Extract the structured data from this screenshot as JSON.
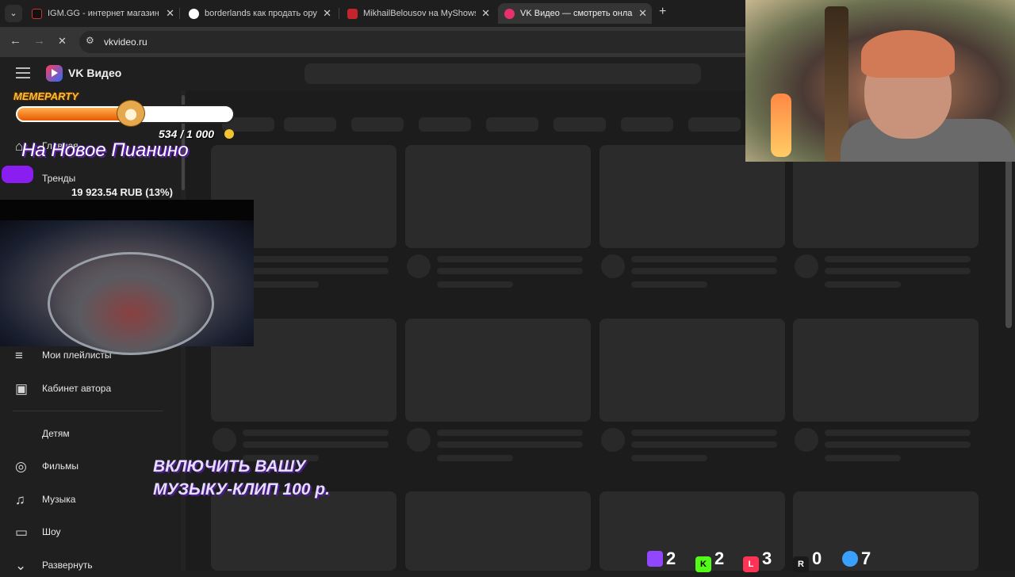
{
  "browser": {
    "tabs": [
      {
        "title": "IGM.GG - интернет магазин кл",
        "favicon_color": "#111111",
        "active": false
      },
      {
        "title": "borderlands как продать оруж",
        "favicon_color": "#4285f4",
        "active": false
      },
      {
        "title": "MikhailBelousov на MyShows.r",
        "favicon_color": "#c4252c",
        "active": false
      },
      {
        "title": "VK Видео — смотреть онлайн",
        "favicon_color": "#e8306b",
        "active": true
      }
    ],
    "url": "vkvideo.ru"
  },
  "app": {
    "title": "VK Видео"
  },
  "sidebar": {
    "items": [
      {
        "label": "Главная",
        "icon": "home-icon"
      },
      {
        "label": "Тренды",
        "icon": "trend-icon"
      },
      {
        "label": "Мои плейлисты",
        "icon": "playlist-add-icon"
      },
      {
        "label": "Кабинет автора",
        "icon": "chart-icon"
      },
      {
        "label": "Детям",
        "icon": ""
      },
      {
        "label": "Фильмы",
        "icon": "film-icon"
      },
      {
        "label": "Музыка",
        "icon": "music-icon"
      },
      {
        "label": "Шоу",
        "icon": "tv-icon"
      },
      {
        "label": "Развернуть",
        "icon": "chevron-down-icon"
      }
    ]
  },
  "overlay": {
    "donation_brand": "MEMEPARTY",
    "goal_progress": "534 / 1 000",
    "goal_fraction": 0.534,
    "goal_title": "На Новое Пианино",
    "goal_amount": "19 923.54 RUB (13%)",
    "promo_line1": "ВКЛЮЧИТЬ ВАШУ",
    "promo_line2": "МУЗЫКУ-КЛИП 100 р.",
    "viewers": [
      {
        "platform": "twitch",
        "count": "2",
        "color": "#9146ff"
      },
      {
        "platform": "kick",
        "count": "2",
        "color": "#53fc18"
      },
      {
        "platform": "vk-live",
        "count": "3",
        "color": "#ff3355"
      },
      {
        "platform": "rutube",
        "count": "0",
        "color": "#e8e8e8"
      },
      {
        "platform": "total",
        "count": "7",
        "color": "#3aa0ff"
      }
    ]
  }
}
